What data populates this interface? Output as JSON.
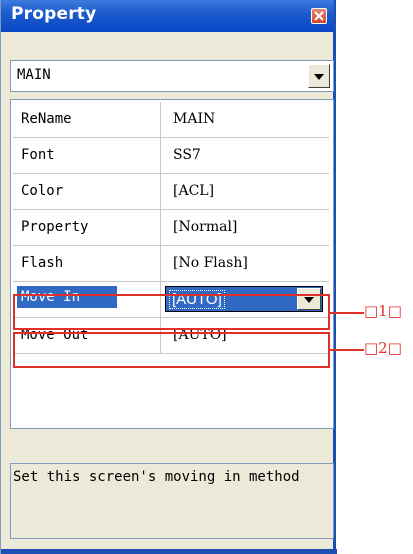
{
  "window": {
    "title": "Property",
    "close_icon": "close-icon"
  },
  "object_selector": {
    "value": "MAIN"
  },
  "properties": [
    {
      "name": "ReName",
      "value": "MAIN"
    },
    {
      "name": "Font",
      "value": "SS7"
    },
    {
      "name": "Color",
      "value": "[ACL]"
    },
    {
      "name": "Property",
      "value": "[Normal]"
    },
    {
      "name": "Flash",
      "value": "[No Flash]"
    },
    {
      "name": "Move In",
      "value": "[AUTO]",
      "selected": true
    },
    {
      "name": "Move Out",
      "value": "[AUTO]"
    }
  ],
  "callouts": [
    {
      "label": "□1□"
    },
    {
      "label": "□2□"
    }
  ],
  "description": "Set this screen's moving in method",
  "colors": {
    "titlebar": "#0a47c7",
    "selection": "#316ac5",
    "annotation": "#e0302a"
  }
}
